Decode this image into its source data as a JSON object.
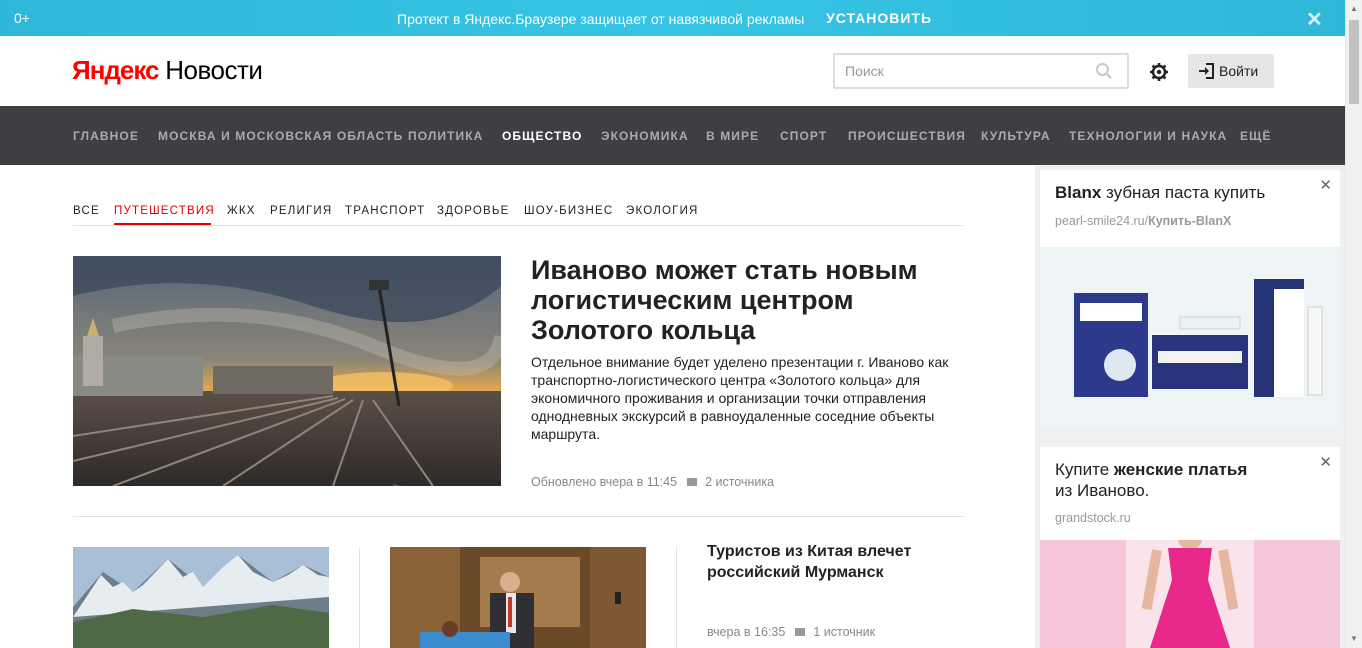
{
  "promo": {
    "age_label": "0+",
    "message": "Протект в Яндекс.Браузере защищает от навязчивой рекламы",
    "install_label": "УСТАНОВИТЬ",
    "close_glyph": "✕"
  },
  "header": {
    "logo_brand": "Яндекс",
    "logo_service": "Новости",
    "search_placeholder": "Поиск",
    "login_label": "Войти"
  },
  "main_nav": [
    "ГЛАВНОЕ",
    "МОСКВА И МОСКОВСКАЯ ОБЛАСТЬ",
    "ПОЛИТИКА",
    "ОБЩЕСТВО",
    "ЭКОНОМИКА",
    "В МИРЕ",
    "СПОРТ",
    "ПРОИСШЕСТВИЯ",
    "КУЛЬТУРА",
    "ТЕХНОЛОГИИ И НАУКА",
    "ЕЩЁ"
  ],
  "main_nav_active": "ОБЩЕСТВО",
  "sub_nav": [
    "ВСЕ",
    "ПУТЕШЕСТВИЯ",
    "ЖКХ",
    "РЕЛИГИЯ",
    "ТРАНСПОРТ",
    "ЗДОРОВЬЕ",
    "ШОУ-БИЗНЕС",
    "ЭКОЛОГИЯ"
  ],
  "sub_nav_active": "ПУТЕШЕСТВИЯ",
  "lead": {
    "title": "Иваново может стать новым логистическим центром Золотого кольца",
    "text": "Отдельное внимание будет уделено презентации г. Иваново как транспортно-логистического центра «Золотого кольца» для экономичного проживания и организации точки отправления однодневных экскурсий в равноудаленные соседние объекты маршрута.",
    "updated": "Обновлено вчера в 11:45",
    "sources": "2 источника"
  },
  "card3": {
    "title": "Туристов из Китая влечет российский Мурманск",
    "time": "вчера в 16:35",
    "sources": "1 источник"
  },
  "ads": [
    {
      "title_bold": "Blanx",
      "title_rest": " зубная паста купить",
      "domain": "pearl-smile24.ru/",
      "domain_bold": "Купить-BlanX",
      "close": "✕"
    },
    {
      "title_pre": "Купите ",
      "title_bold": "женские платья",
      "title_post": "из Иваново.",
      "domain": "grandstock.ru",
      "close": "✕"
    }
  ],
  "colors": {
    "accent_red": "#dd0000",
    "nav_bg": "#3d3f43",
    "promo_bg": "#35c4e4"
  },
  "icons": [
    "search-icon",
    "gear-icon",
    "login-icon",
    "close-icon",
    "source-icon"
  ]
}
